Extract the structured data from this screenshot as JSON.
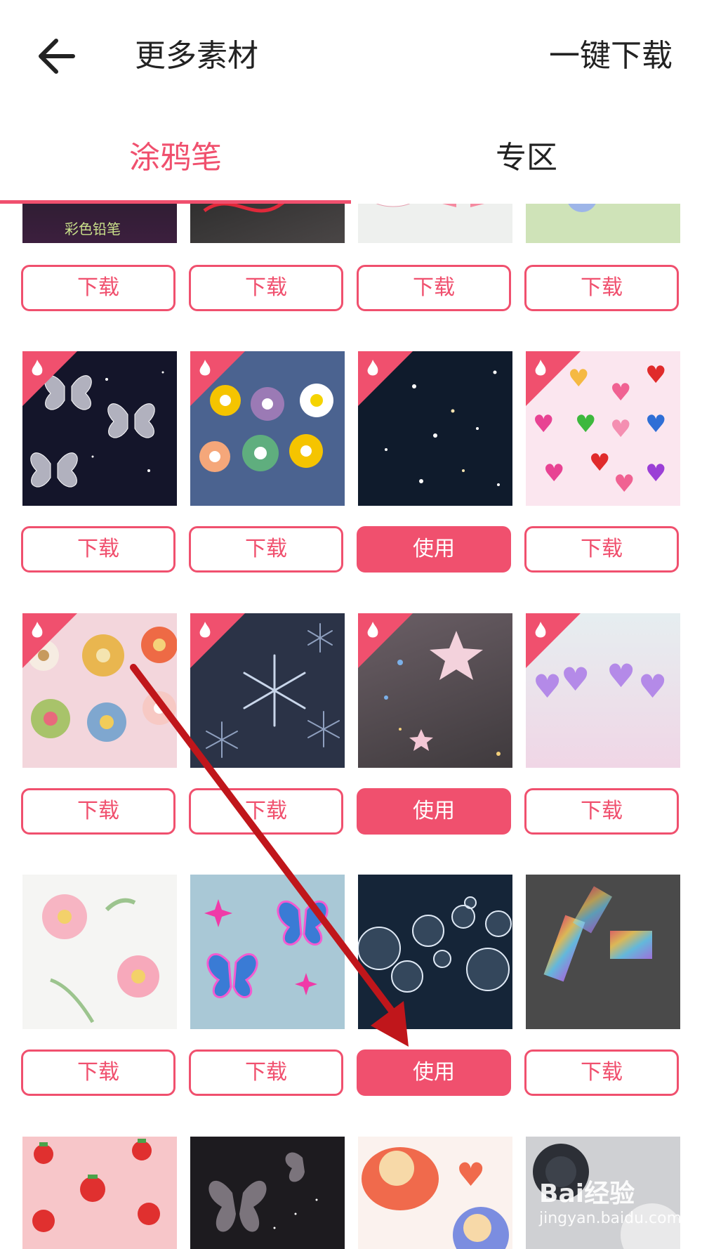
{
  "header": {
    "title": "更多素材",
    "action": "一键下载"
  },
  "tabs": [
    {
      "label": "涂鸦笔",
      "active": true
    },
    {
      "label": "专区",
      "active": false
    }
  ],
  "buttons": {
    "download": "下载",
    "use": "使用"
  },
  "grid": {
    "rows": [
      {
        "items": [
          {
            "state": "download",
            "hot": false,
            "caption": "彩色铅笔"
          },
          {
            "state": "download",
            "hot": false
          },
          {
            "state": "download",
            "hot": false
          },
          {
            "state": "download",
            "hot": false
          }
        ]
      },
      {
        "items": [
          {
            "state": "download",
            "hot": true
          },
          {
            "state": "download",
            "hot": true
          },
          {
            "state": "use",
            "hot": true
          },
          {
            "state": "download",
            "hot": true
          }
        ]
      },
      {
        "items": [
          {
            "state": "download",
            "hot": true
          },
          {
            "state": "download",
            "hot": true
          },
          {
            "state": "use",
            "hot": true
          },
          {
            "state": "download",
            "hot": true
          }
        ]
      },
      {
        "items": [
          {
            "state": "download",
            "hot": false
          },
          {
            "state": "download",
            "hot": false
          },
          {
            "state": "use",
            "hot": false
          },
          {
            "state": "download",
            "hot": false
          }
        ]
      },
      {
        "items": [
          {
            "state": "none",
            "hot": false
          },
          {
            "state": "none",
            "hot": false
          },
          {
            "state": "none",
            "hot": false
          },
          {
            "state": "none",
            "hot": false
          }
        ]
      }
    ]
  },
  "colors": {
    "accent": "#f0506e",
    "annotation_arrow": "#c0161b"
  },
  "watermark": {
    "brand": "Bai经验",
    "url": "jingyan.baidu.com"
  }
}
